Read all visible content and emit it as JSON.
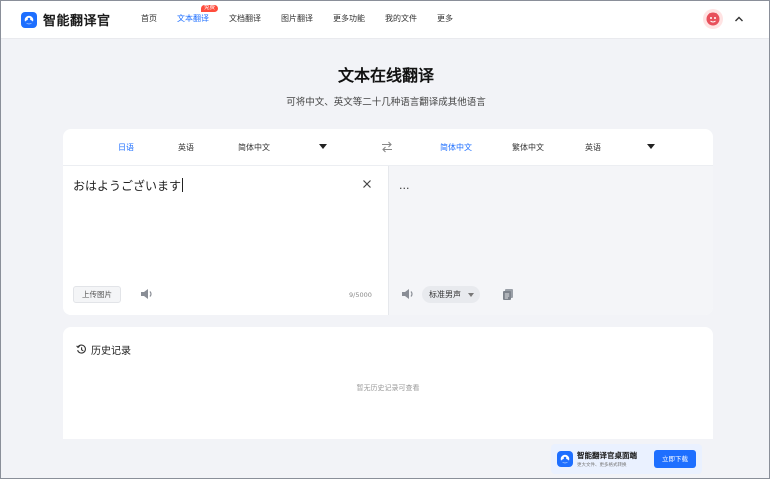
{
  "brand": {
    "name": "智能翻译官"
  },
  "nav": {
    "items": [
      {
        "label": "首页"
      },
      {
        "label": "文本翻译",
        "badge": "免费"
      },
      {
        "label": "文档翻译"
      },
      {
        "label": "图片翻译"
      },
      {
        "label": "更多功能"
      },
      {
        "label": "我的文件"
      },
      {
        "label": "更多"
      }
    ],
    "active_index": 1
  },
  "hero": {
    "title": "文本在线翻译",
    "subtitle": "可将中文、英文等二十几种语言翻译成其他语言"
  },
  "source_langs": [
    {
      "label": "日语",
      "active": true
    },
    {
      "label": "英语",
      "active": false
    },
    {
      "label": "简体中文",
      "active": false
    }
  ],
  "target_langs": [
    {
      "label": "简体中文",
      "active": true
    },
    {
      "label": "繁体中文",
      "active": false
    },
    {
      "label": "英语",
      "active": false
    }
  ],
  "source": {
    "text": "おはようございます",
    "upload_label": "上传图片",
    "char_count": "9/5000"
  },
  "target": {
    "text": "...",
    "voice_label": "标准男声"
  },
  "history": {
    "title": "历史记录",
    "empty_text": "暂无历史记录可查看"
  },
  "promo": {
    "title": "智能翻译官桌面端",
    "subtitle": "更大文件、更多格式转换",
    "button": "立即下载"
  },
  "colors": {
    "accent": "#1e6fff",
    "badge": "#ff4d3d",
    "page_bg": "#f2f3f7",
    "target_pane_bg": "#f4f5f8"
  },
  "icons": {
    "brand_logo": "translate-logo-icon",
    "avatar": "user-avatar-icon",
    "collapse": "chevron-up-icon",
    "swap": "swap-icon",
    "clear": "close-icon",
    "speaker": "speaker-icon",
    "copy": "copy-icon",
    "history": "history-clock-icon"
  }
}
